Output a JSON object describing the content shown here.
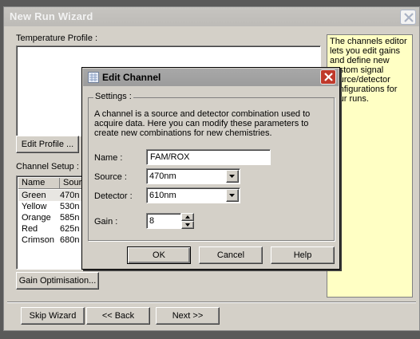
{
  "wizard": {
    "title": "New Run Wizard",
    "temperature_profile_label": "Temperature Profile :",
    "edit_profile_label": "Edit Profile ...",
    "channel_setup_label": "Channel Setup :",
    "columns": [
      "Name",
      "Sourc"
    ],
    "channels": [
      {
        "name": "Green",
        "source": "470n"
      },
      {
        "name": "Yellow",
        "source": "530n"
      },
      {
        "name": "Orange",
        "source": "585n"
      },
      {
        "name": "Red",
        "source": "625n"
      },
      {
        "name": "Crimson",
        "source": "680n"
      }
    ],
    "gain_optimisation_label": "Gain Optimisation...",
    "help_text": "The channels editor lets you edit gains and define new custom signal source/detector configurations for your runs.",
    "buttons": {
      "skip": "Skip Wizard",
      "back": "<< Back",
      "next": "Next >>"
    }
  },
  "dialog": {
    "title": "Edit Channel",
    "settings_label": "Settings :",
    "description": "A channel is a source and detector combination used to acquire data. Here you can modify these parameters to create new combinations for new chemistries.",
    "name_label": "Name :",
    "name_value": "FAM/ROX",
    "source_label": "Source :",
    "source_value": "470nm",
    "detector_label": "Detector :",
    "detector_value": "610nm",
    "gain_label": "Gain :",
    "gain_value": "8",
    "ok_label": "OK",
    "cancel_label": "Cancel",
    "help_label": "Help"
  },
  "colors": {
    "help_panel_bg": "#ffffc4",
    "dialog_close_red": "#c0392b",
    "window_face": "#d4d0c8"
  },
  "icons": {
    "wizard_close": "close-icon",
    "dialog_close": "close-icon",
    "dialog_app": "app-icon",
    "dropdown": "chevron-down-icon",
    "spin_up": "arrow-up-icon",
    "spin_down": "arrow-down-icon"
  }
}
